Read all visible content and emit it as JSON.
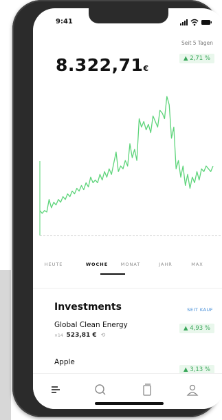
{
  "status_bar": {
    "time": "9:41"
  },
  "portfolio": {
    "value": "8.322,71",
    "currency": "€",
    "period_caption": "Seit 5 Tagen",
    "change": "▲ 2,71 %"
  },
  "chart_data": {
    "type": "line",
    "title": "",
    "xlabel": "",
    "ylabel": "",
    "series": [
      {
        "color": "#5dd47a",
        "values": [
          12,
          11,
          12,
          11.5,
          16,
          13,
          15,
          14,
          16,
          15,
          17,
          16,
          18,
          17,
          19,
          18,
          20,
          19,
          21,
          19.5,
          22,
          20.5,
          24,
          22,
          23,
          22,
          25,
          23,
          26,
          24,
          27,
          25,
          29,
          33,
          26,
          28,
          27,
          30,
          28,
          36,
          31,
          34,
          30,
          45,
          42,
          44,
          41,
          43,
          40,
          46,
          44,
          42,
          48,
          47,
          45,
          53,
          50,
          38,
          42,
          27,
          30,
          24,
          28,
          21,
          25,
          20,
          24,
          22,
          26,
          23,
          27,
          26,
          28,
          27,
          26,
          28
        ]
      }
    ],
    "grid": false,
    "legend": "none"
  },
  "range_tabs": [
    {
      "label": "HEUTE",
      "active": false
    },
    {
      "label": "WOCHE",
      "active": true
    },
    {
      "label": "MONAT",
      "active": false
    },
    {
      "label": "JAHR",
      "active": false
    },
    {
      "label": "MAX",
      "active": false
    }
  ],
  "investments": {
    "title": "Investments",
    "link": "SEIT KAUF",
    "items": [
      {
        "name": "Global Clean Energy",
        "quantity": "×14",
        "value": "523,81 €",
        "change": "▲ 4,93 %"
      },
      {
        "name": "Apple",
        "quantity": "",
        "value": "",
        "change": "▲ 3,13 %"
      }
    ]
  },
  "tab_bar": {
    "items": [
      {
        "icon": "list-icon",
        "active": true
      },
      {
        "icon": "search-icon",
        "active": false
      },
      {
        "icon": "document-icon",
        "active": false
      },
      {
        "icon": "profile-icon",
        "active": false
      }
    ]
  }
}
